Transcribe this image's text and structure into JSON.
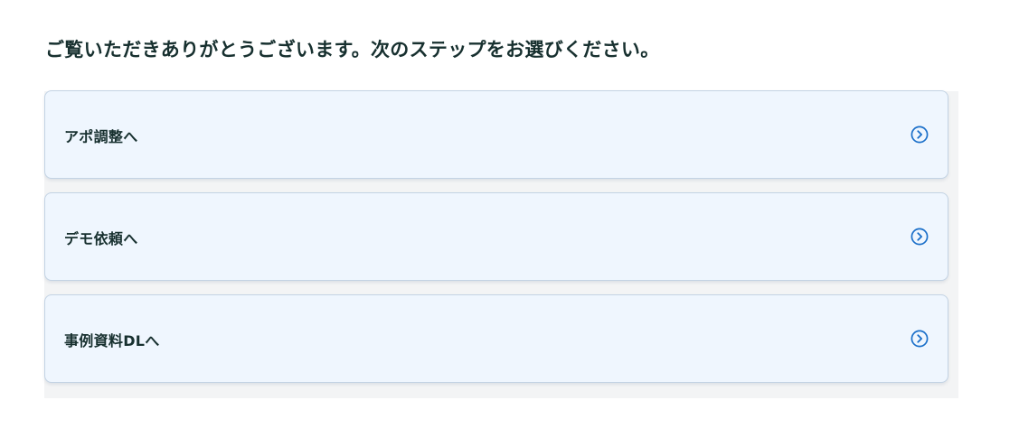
{
  "heading": "ご覧いただきありがとうございます。次のステップをお選びください。",
  "options": [
    {
      "label": "アポ調整へ",
      "icon": "chevron-right-circle-icon"
    },
    {
      "label": "デモ依頼へ",
      "icon": "chevron-right-circle-icon"
    },
    {
      "label": "事例資料DLへ",
      "icon": "chevron-right-circle-icon"
    }
  ],
  "colors": {
    "text": "#17302f",
    "card_background": "#eff6fe",
    "card_border": "#c3d3e4",
    "accent": "#1a6fc9"
  }
}
